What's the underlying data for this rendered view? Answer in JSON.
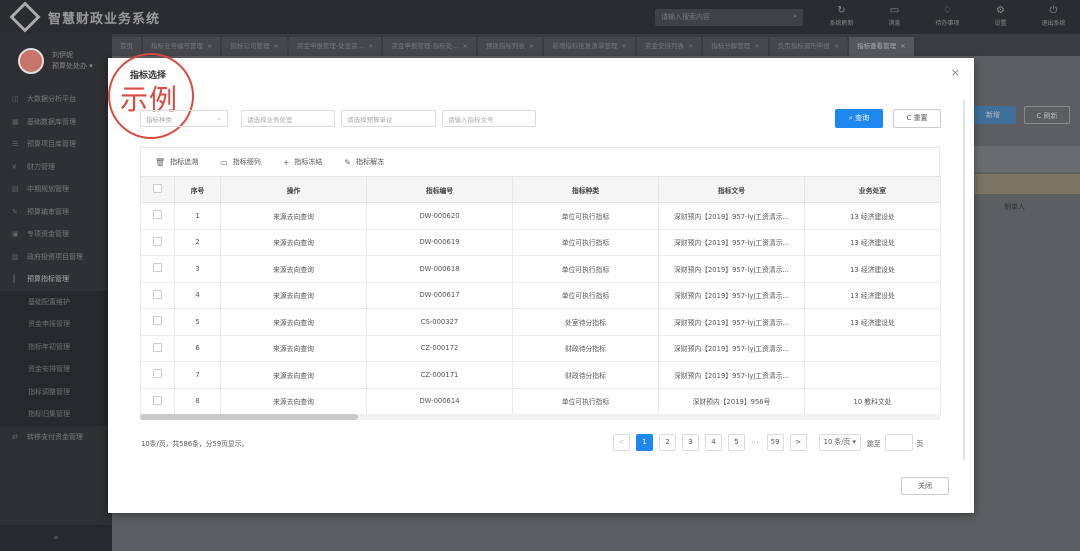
{
  "app": {
    "title": "智慧财政业务系统"
  },
  "top_search": {
    "placeholder": "请输入搜索内容"
  },
  "top_tools": [
    {
      "icon": "refresh-icon",
      "glyph": "↻",
      "label": "系统刷新"
    },
    {
      "icon": "message-icon",
      "glyph": "▭",
      "label": "消息"
    },
    {
      "icon": "bell-icon",
      "glyph": "♢",
      "label": "待办事项"
    },
    {
      "icon": "gear-icon",
      "glyph": "⚙",
      "label": "设置"
    },
    {
      "icon": "power-icon",
      "glyph": "⏻",
      "label": "退出系统"
    }
  ],
  "user": {
    "name": "刘伊妮",
    "role": "预算处处办 ▾"
  },
  "sidebar": {
    "items": [
      {
        "label": "大数据分析平台"
      },
      {
        "label": "基础数据库管理"
      },
      {
        "label": "预算项目库管理"
      },
      {
        "label": "财力管理"
      },
      {
        "label": "中期规划管理"
      },
      {
        "label": "预算编审管理"
      },
      {
        "label": "专项资金管理"
      },
      {
        "label": "政府投资项目管理"
      }
    ],
    "open_item": {
      "label": "预算指标管理"
    },
    "sub_items": [
      {
        "label": "基础配置维护"
      },
      {
        "label": "资金申报管理"
      },
      {
        "label": "指标年初管理"
      },
      {
        "label": "资金安排管理"
      },
      {
        "label": "指标调整管理"
      },
      {
        "label": "指标归集管理"
      }
    ],
    "last_item": {
      "label": "转移支付资金管理"
    },
    "collapse": "«"
  },
  "tabs": [
    {
      "label": "首页"
    },
    {
      "label": "指标业务编号管理"
    },
    {
      "label": "指标公司管理"
    },
    {
      "label": "资金申报管理-处室资..."
    },
    {
      "label": "资金申报管理-指标处..."
    },
    {
      "label": "预拨指标列表"
    },
    {
      "label": "新增指标批复清单管理"
    },
    {
      "label": "资金安排列表"
    },
    {
      "label": "指标分解管理"
    },
    {
      "label": "负责指标调剂申报"
    },
    {
      "label": "指标查看管理"
    }
  ],
  "background": {
    "btn_add": "新增",
    "btn_refresh": "C 刷新",
    "col_creator": "制单人"
  },
  "modal": {
    "title": "指标选择",
    "stamp": "示例",
    "filters": {
      "type_placeholder": "指标种类",
      "office_placeholder": "请选择业务处室",
      "unit_placeholder": "请选择预算单位",
      "doc_placeholder": "请输入指标文号"
    },
    "search_label": "查询",
    "reset_label": "重置",
    "toolbar": {
      "trace": "指标追溯",
      "detail": "指标细列",
      "freeze": "指标冻结",
      "unfreeze": "指标解冻"
    },
    "columns": {
      "index": "序号",
      "action": "操作",
      "code": "指标编号",
      "type": "指标种类",
      "doc": "指标文号",
      "office": "业务处室"
    },
    "rows": [
      {
        "index": "1",
        "action": "来源去向查询",
        "code": "DW-000620",
        "type": "单位可执行指标",
        "doc": "深财预内【2019】957-lyj工资清示...",
        "office": "13 经济建设处"
      },
      {
        "index": "2",
        "action": "来源去向查询",
        "code": "DW-000619",
        "type": "单位可执行指标",
        "doc": "深财预内【2019】957-lyj工资清示...",
        "office": "13 经济建设处"
      },
      {
        "index": "3",
        "action": "来源去向查询",
        "code": "DW-000618",
        "type": "单位可执行指标",
        "doc": "深财预内【2019】957-lyj工资清示...",
        "office": "13 经济建设处"
      },
      {
        "index": "4",
        "action": "来源去向查询",
        "code": "DW-000617",
        "type": "单位可执行指标",
        "doc": "深财预内【2019】957-lyj工资清示...",
        "office": "13 经济建设处"
      },
      {
        "index": "5",
        "action": "来源去向查询",
        "code": "CS-000327",
        "type": "处室待分指标",
        "doc": "深财预内【2019】957-lyj工资清示...",
        "office": "13 经济建设处"
      },
      {
        "index": "6",
        "action": "来源去向查询",
        "code": "CZ-000172",
        "type": "财政待分指标",
        "doc": "深财预内【2019】957-lyj工资清示...",
        "office": ""
      },
      {
        "index": "7",
        "action": "来源去向查询",
        "code": "CZ-000171",
        "type": "财政待分指标",
        "doc": "深财预内【2019】957-lyj工资清示...",
        "office": ""
      },
      {
        "index": "8",
        "action": "来源去向查询",
        "code": "DW-000614",
        "type": "单位可执行指标",
        "doc": "深财预内【2019】956号",
        "office": "10 教科文处"
      }
    ],
    "pager": {
      "info": "10条/页，共586条，分59页显示。",
      "prev": "<",
      "pages": [
        "1",
        "2",
        "3",
        "4",
        "5"
      ],
      "dots": "···",
      "last": "59",
      "next": ">",
      "size": "10 条/页 ▾",
      "jump_label": "跳至",
      "page_label": "页"
    },
    "close_label": "关闭"
  }
}
